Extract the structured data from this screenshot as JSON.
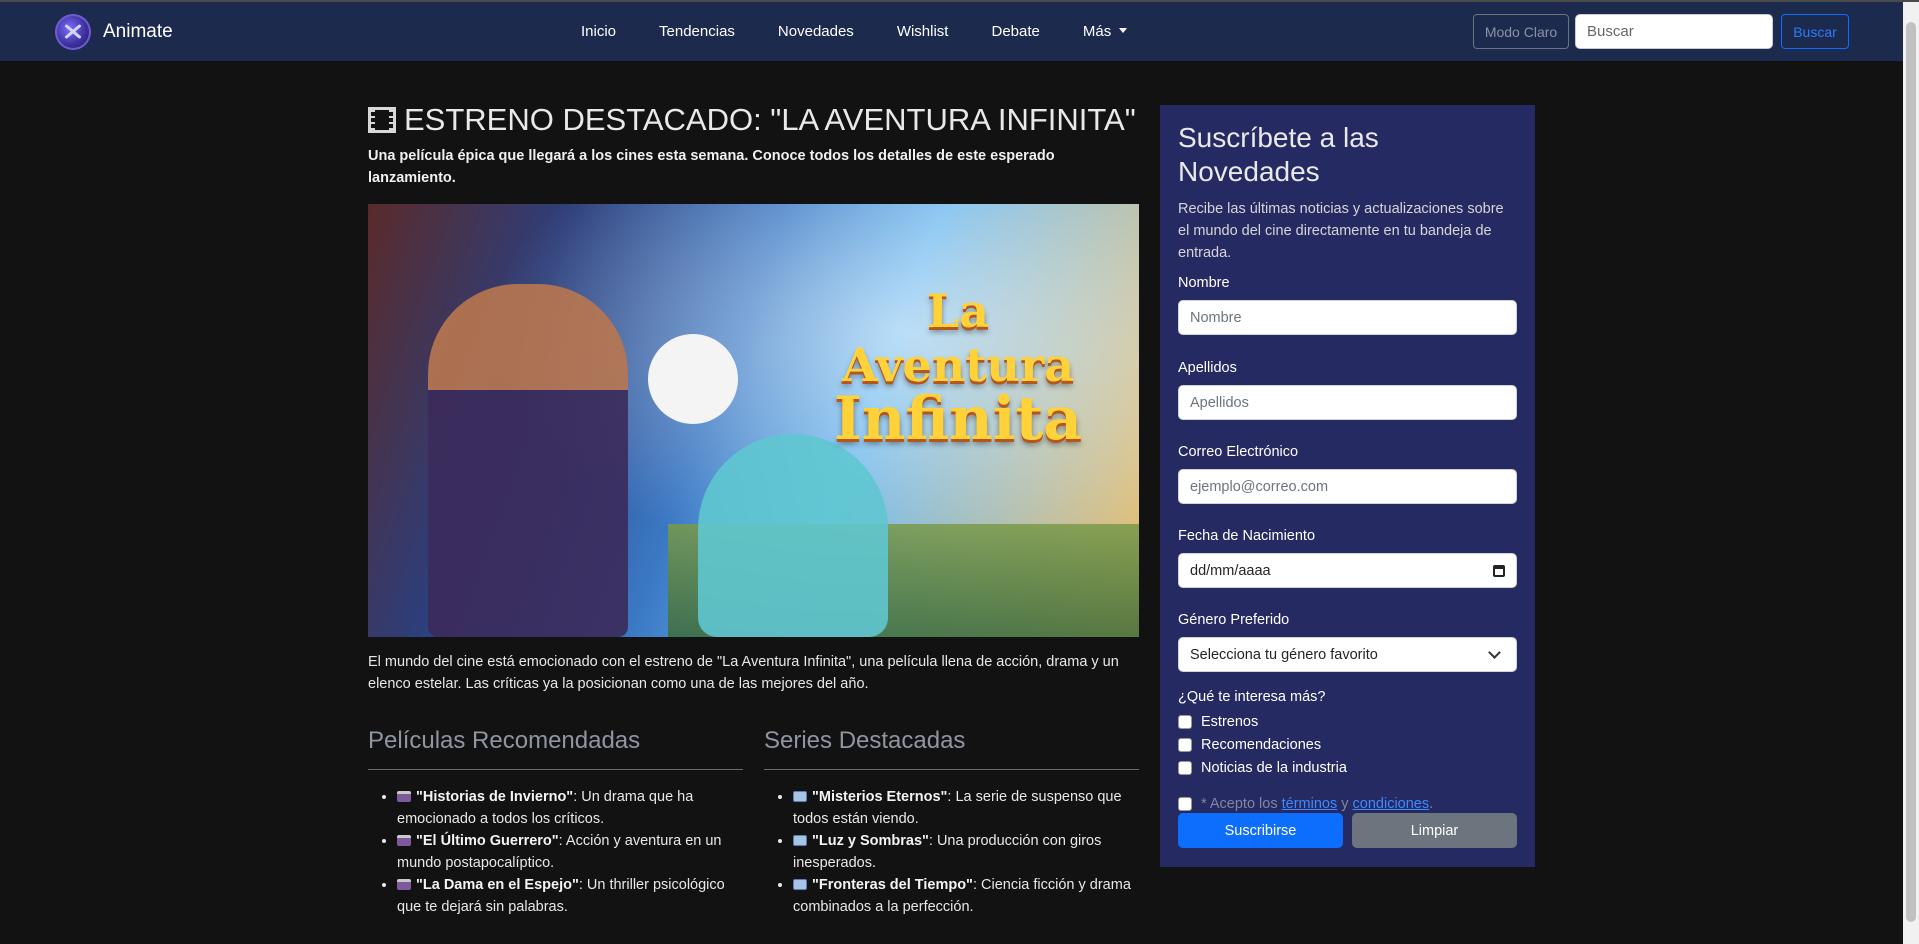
{
  "nav": {
    "brand": "Animate",
    "links": [
      "Inicio",
      "Tendencias",
      "Novedades",
      "Wishlist",
      "Debate",
      "Más"
    ],
    "mode_button": "Modo Claro",
    "search_placeholder": "Buscar",
    "search_button": "Buscar"
  },
  "hero": {
    "title": "ESTRENO DESTACADO: \"LA AVENTURA INFINITA\"",
    "lead": "Una película épica que llegará a los cines esta semana. Conoce todos los detalles de este esperado lanzamiento.",
    "image_title_1": "La Aventura",
    "image_title_2": "Infinita",
    "body": "El mundo del cine está emocionado con el estreno de \"La Aventura Infinita\", una película llena de acción, drama y un elenco estelar. Las críticas ya la posicionan como una de las mejores del año."
  },
  "movies": {
    "heading": "Películas Recomendadas",
    "items": [
      {
        "title": "\"Historias de Invierno\"",
        "text": ": Un drama que ha emocionado a todos los críticos."
      },
      {
        "title": "\"El Último Guerrero\"",
        "text": ": Acción y aventura en un mundo postapocalíptico."
      },
      {
        "title": "\"La Dama en el Espejo\"",
        "text": ": Un thriller psicológico que te dejará sin palabras."
      }
    ]
  },
  "series": {
    "heading": "Series Destacadas",
    "items": [
      {
        "title": "\"Misterios Eternos\"",
        "text": ": La serie de suspenso que todos están viendo."
      },
      {
        "title": "\"Luz y Sombras\"",
        "text": ": Una producción con giros inesperados."
      },
      {
        "title": "\"Fronteras del Tiempo\"",
        "text": ": Ciencia ficción y drama combinados a la perfección."
      }
    ]
  },
  "subscribe": {
    "title": "Suscríbete a las Novedades",
    "description": "Recibe las últimas noticias y actualizaciones sobre el mundo del cine directamente en tu bandeja de entrada.",
    "name_label": "Nombre",
    "name_placeholder": "Nombre",
    "surname_label": "Apellidos",
    "surname_placeholder": "Apellidos",
    "email_label": "Correo Electrónico",
    "email_placeholder": "ejemplo@correo.com",
    "birth_label": "Fecha de Nacimiento",
    "birth_value": "dd/mm/aaaa",
    "genre_label": "Género Preferido",
    "genre_value": "Selecciona tu género favorito",
    "interests_label": "¿Qué te interesa más?",
    "interests": [
      "Estrenos",
      "Recomendaciones",
      "Noticias de la industria"
    ],
    "terms_prefix": "* Acepto los ",
    "terms_link": "términos",
    "terms_and": " y ",
    "conditions_link": "condiciones",
    "terms_suffix": ".",
    "submit": "Suscribirse",
    "clear": "Limpiar"
  },
  "colors": {
    "navbar": "#1c2a4d",
    "panel": "#262a62",
    "primary": "#0d6efd",
    "secondary": "#6c757d"
  }
}
